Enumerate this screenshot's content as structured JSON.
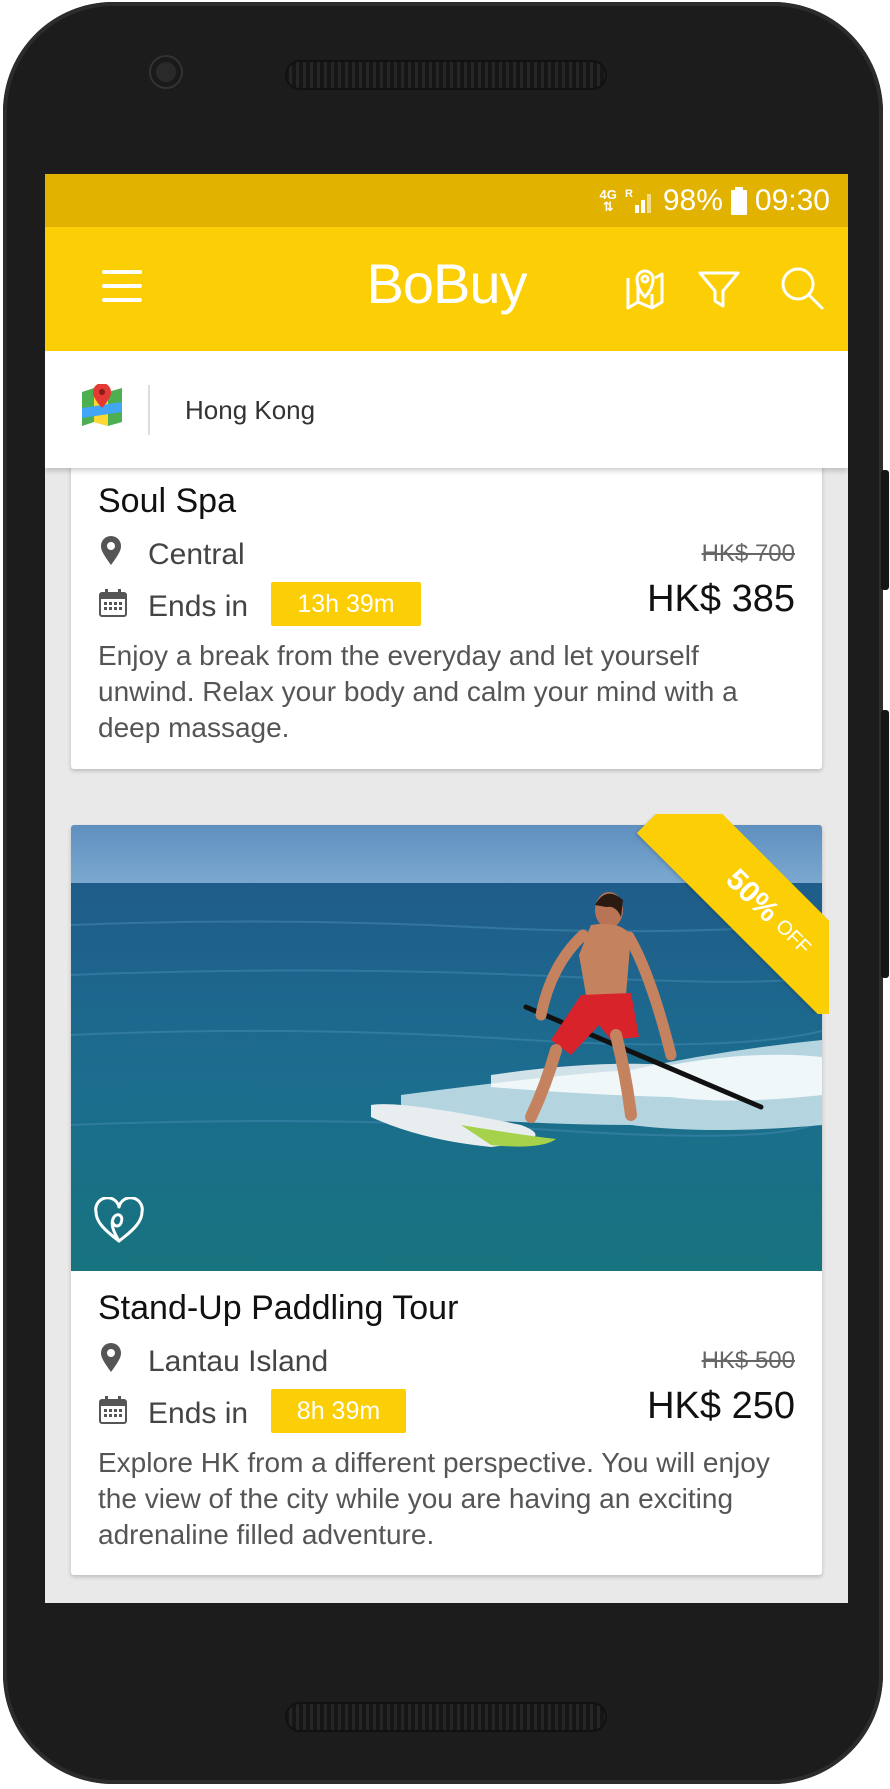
{
  "statusbar": {
    "network": "4G",
    "battery": "98%",
    "time": "09:30"
  },
  "appbar": {
    "title": "BoBuy",
    "accent_color": "#fcce05",
    "icons": [
      "menu-icon",
      "map-icon",
      "filter-icon",
      "search-icon"
    ]
  },
  "location": {
    "city": "Hong Kong"
  },
  "deals": [
    {
      "title": "Soul Spa",
      "area": "Central",
      "old_price": "HK$ 700",
      "ends_label": "Ends in",
      "timer": "13h 39m",
      "price": "HK$ 385",
      "description": "Enjoy a break from the everyday and let yourself unwind. Relax your body and calm your mind with a deep massage."
    },
    {
      "title": "Stand-Up Paddling Tour",
      "area": "Lantau Island",
      "old_price": "HK$ 500",
      "ends_label": "Ends in",
      "timer": "8h 39m",
      "price": "HK$ 250",
      "description": "Explore HK from a different perspective. You will enjoy the view of the city while you are having an exciting adrenaline filled adventure.",
      "discount_percent": "50%",
      "discount_word": "OFF"
    }
  ]
}
